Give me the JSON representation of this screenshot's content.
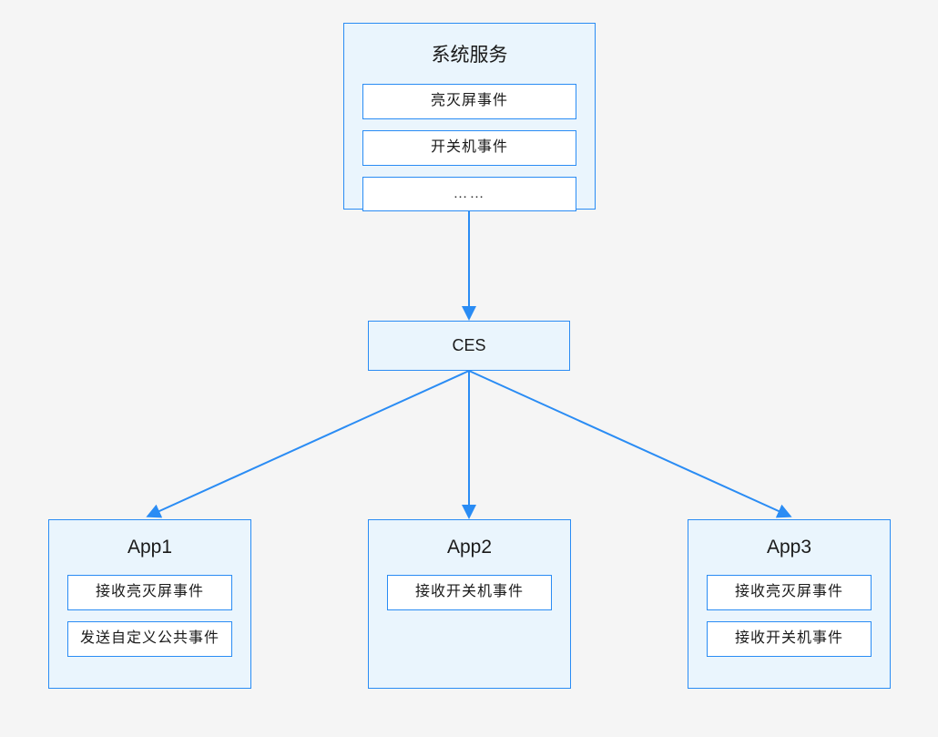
{
  "systemService": {
    "title": "系统服务",
    "items": [
      "亮灭屏事件",
      "开关机事件",
      "……"
    ]
  },
  "ces": {
    "label": "CES"
  },
  "apps": [
    {
      "title": "App1",
      "items": [
        "接收亮灭屏事件",
        "发送自定义公共事件"
      ]
    },
    {
      "title": "App2",
      "items": [
        "接收开关机事件"
      ]
    },
    {
      "title": "App3",
      "items": [
        "接收亮灭屏事件",
        "接收开关机事件"
      ]
    }
  ]
}
